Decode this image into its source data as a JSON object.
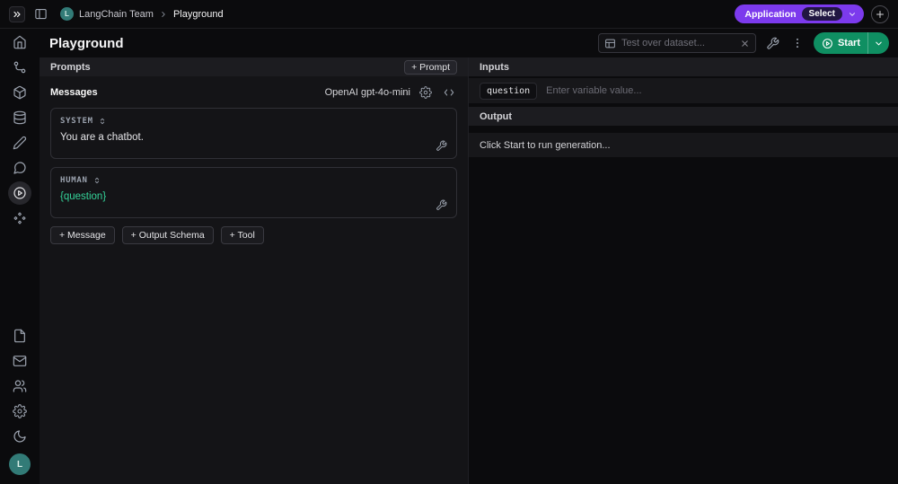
{
  "topbar": {
    "team_avatar_letter": "L",
    "team_name": "LangChain Team",
    "breadcrumb_current": "Playground",
    "application_label": "Application",
    "select_label": "Select"
  },
  "header": {
    "title": "Playground",
    "dataset_input_placeholder": "Test over dataset...",
    "start_label": "Start"
  },
  "prompts_panel": {
    "header": "Prompts",
    "add_prompt_label": "+ Prompt",
    "messages_header": "Messages",
    "model_label": "OpenAI gpt-4o-mini",
    "messages": [
      {
        "role": "SYSTEM",
        "content": "You are a chatbot."
      },
      {
        "role": "HUMAN",
        "content": "{question}"
      }
    ],
    "add_message_label": "+ Message",
    "add_output_schema_label": "+ Output Schema",
    "add_tool_label": "+ Tool"
  },
  "io_panel": {
    "inputs_header": "Inputs",
    "variable_name": "question",
    "variable_placeholder": "Enter variable value...",
    "output_header": "Output",
    "output_empty_text": "Click Start to run generation..."
  },
  "sidebar": {
    "avatar_letter": "L"
  },
  "colors": {
    "accent_purple": "#7c3aed",
    "accent_green": "#0f8f62",
    "variable_green": "#34d399",
    "avatar_teal": "#327b77"
  },
  "icons": [
    "langsmith-logo",
    "panel-toggle-icon",
    "chevron-right-icon",
    "chevron-down-icon",
    "plus-icon",
    "dataset-icon",
    "clear-icon",
    "wrench-icon",
    "kebab-icon",
    "play-circle-icon",
    "gear-icon",
    "code-icon",
    "sort-icon",
    "home-icon",
    "route-icon",
    "box-icon",
    "database-icon",
    "pencil-icon",
    "chat-bubble-icon",
    "modules-icon",
    "document-icon",
    "mail-icon",
    "users-icon",
    "settings-icon",
    "moon-icon",
    "user-avatar"
  ]
}
